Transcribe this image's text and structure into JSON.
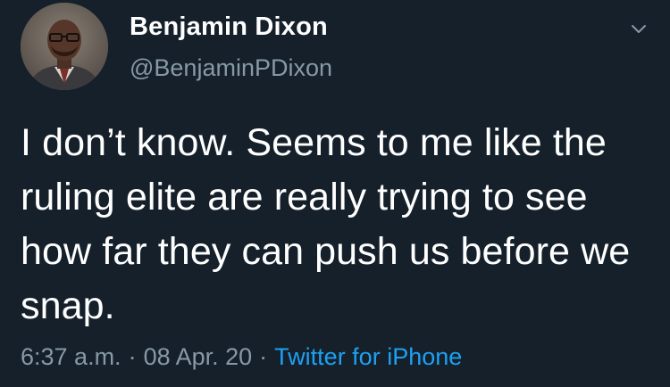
{
  "tweet": {
    "author": {
      "display_name": "Benjamin Dixon",
      "handle": "@BenjaminPDixon"
    },
    "text": "I don’t know. Seems to me like the ruling elite are really trying to see how far they can push us before we snap.",
    "time": "6:37 a.m.",
    "date": "08 Apr. 20",
    "separator": "·",
    "source": "Twitter for iPhone"
  },
  "icons": {
    "avatar": "profile-photo",
    "menu": "chevron-down-icon"
  },
  "colors": {
    "background": "#15202b",
    "primary_text": "#ffffff",
    "secondary_text": "#8899a6",
    "link": "#1da1f2"
  }
}
